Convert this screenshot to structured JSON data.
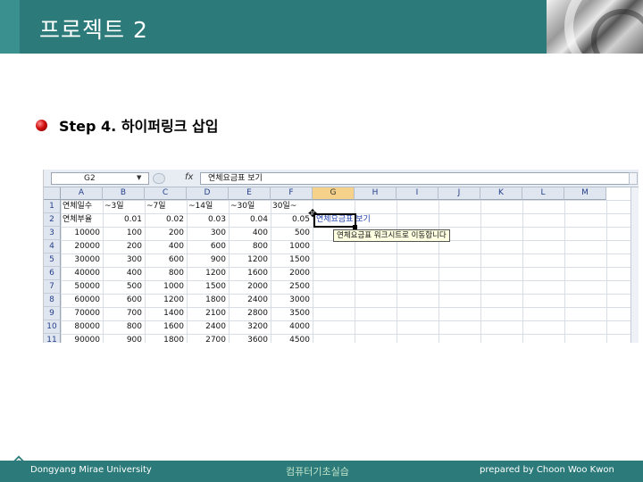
{
  "header": {
    "title": "프로젝트 2"
  },
  "step": {
    "text": "Step 4. 하이퍼링크 삽입"
  },
  "spreadsheet": {
    "name_box": "G2",
    "fx_symbol": "fx",
    "formula": "연체요금표 보기",
    "columns": [
      "A",
      "B",
      "C",
      "D",
      "E",
      "F",
      "G",
      "H",
      "I",
      "J",
      "K",
      "L",
      "M"
    ],
    "selected_column": "G",
    "rows": [
      [
        "연체일수",
        "~3일",
        "~7일",
        "~14일",
        "~30일",
        "30일~"
      ],
      [
        "연체부율",
        "0.01",
        "0.02",
        "0.03",
        "0.04",
        "0.05"
      ],
      [
        "10000",
        "100",
        "200",
        "300",
        "400",
        "500"
      ],
      [
        "20000",
        "200",
        "400",
        "600",
        "800",
        "1000"
      ],
      [
        "30000",
        "300",
        "600",
        "900",
        "1200",
        "1500"
      ],
      [
        "40000",
        "400",
        "800",
        "1200",
        "1600",
        "2000"
      ],
      [
        "50000",
        "500",
        "1000",
        "1500",
        "2000",
        "2500"
      ],
      [
        "60000",
        "600",
        "1200",
        "1800",
        "2400",
        "3000"
      ],
      [
        "70000",
        "700",
        "1400",
        "2100",
        "2800",
        "3500"
      ],
      [
        "80000",
        "800",
        "1600",
        "2400",
        "3200",
        "4000"
      ],
      [
        "90000",
        "900",
        "1800",
        "2700",
        "3600",
        "4500"
      ]
    ],
    "row_numbers": [
      "1",
      "2",
      "3",
      "4",
      "5",
      "6",
      "7",
      "8",
      "9",
      "10",
      "11"
    ],
    "hyperlink_cell": "연체요금표 보기",
    "tooltip": "연체요금표 워크시트로 이동합니다"
  },
  "footer": {
    "left": "Dongyang Mirae University",
    "center": "컴퓨터기초실습",
    "right": "prepared by Choon Woo Kwon"
  },
  "colors": {
    "primary": "#2c7a7a",
    "accent": "#d01010"
  }
}
